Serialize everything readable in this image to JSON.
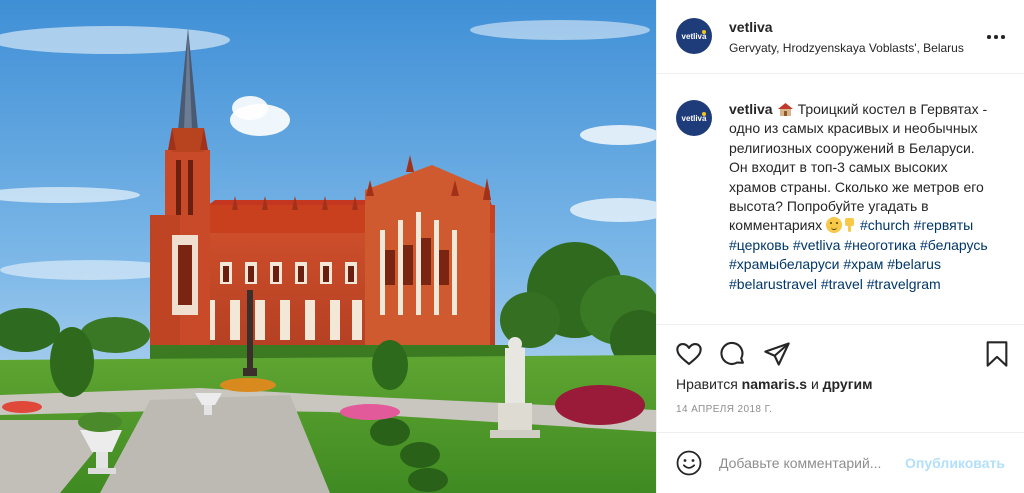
{
  "post": {
    "user": "vetliva",
    "avatar_text": "vetliva",
    "location": "Gervyaty, Hrodzyenskaya Voblasts', Belarus",
    "more_icon": "more-horizontal-icon"
  },
  "caption": {
    "user": "vetliva",
    "text": "Троицкий костел в Гервятах - одно из самых красивых и необычных религиозных сооружений в Беларуси. Он входит в топ-3 самых высоких храмов страны. Сколько же метров его высота? Попробуйте угадать в комментариях",
    "emoji": [
      "house-emoji",
      "smiling-face-emoji",
      "pointing-down-hand-emoji"
    ],
    "hashtags": [
      "#church",
      "#гервяты",
      "#церковь",
      "#vetliva",
      "#неоготика",
      "#беларусь",
      "#храмыбеларуси",
      "#храм",
      "#belarus",
      "#belarustravel",
      "#travel",
      "#travelgram"
    ]
  },
  "actions": {
    "like_icon": "heart-icon",
    "comment_icon": "comment-icon",
    "share_icon": "share-icon",
    "save_icon": "bookmark-icon"
  },
  "likes": {
    "prefix": "Нравится",
    "user": "namaris.s",
    "connector": "и",
    "suffix": "другим"
  },
  "date": "14 АПРЕЛЯ 2018 Г.",
  "comment": {
    "placeholder": "Добавьте комментарий...",
    "publish_label": "Опубликовать",
    "emoji_icon": "smiley-icon"
  },
  "colors": {
    "link": "#00376b",
    "muted": "#8e8e8e",
    "publish_disabled": "#b2dffc",
    "avatar_bg": "#1f3c7a"
  }
}
